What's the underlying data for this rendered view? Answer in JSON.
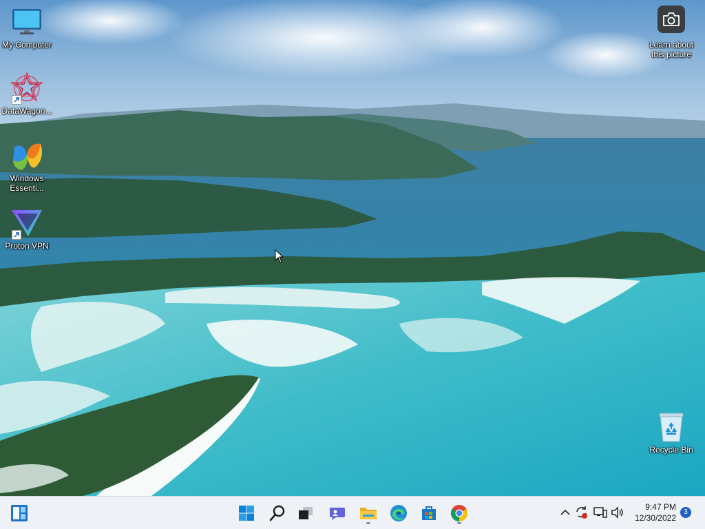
{
  "desktop": {
    "icons": [
      {
        "label": "My Computer"
      },
      {
        "label": "DataWagon..."
      },
      {
        "label": "Windows Essenti..."
      },
      {
        "label": "Proton VPN"
      },
      {
        "label": "Recycle Bin"
      }
    ],
    "spotlight": {
      "label": "Learn about this picture"
    }
  },
  "taskbar": {
    "widgets_label": "Widgets",
    "apps": [
      {
        "name": "Start"
      },
      {
        "name": "Search"
      },
      {
        "name": "Task View"
      },
      {
        "name": "Chat"
      },
      {
        "name": "File Explorer"
      },
      {
        "name": "Microsoft Edge"
      },
      {
        "name": "Microsoft Store"
      },
      {
        "name": "Google Chrome"
      }
    ],
    "clock": {
      "time": "9:47 PM",
      "date": "12/30/2022"
    },
    "notifications": "3"
  },
  "colors": {
    "taskbar_bg": "#eef1f6",
    "accent": "#1f5fbf",
    "win_blue": "#0a84d6"
  }
}
